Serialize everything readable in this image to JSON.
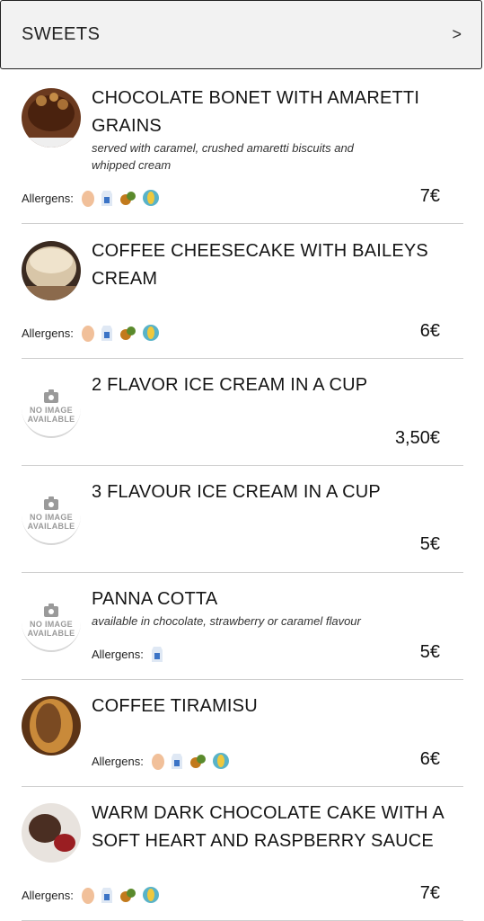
{
  "header": {
    "title": "SWEETS",
    "chevron": ">"
  },
  "allergens_label": "Allergens:",
  "no_image_line1": "NO IMAGE",
  "no_image_line2": "AVAILABLE",
  "items": [
    {
      "name": "CHOCOLATE BONET WITH AMARETTI GRAINS",
      "description": "served with caramel, crushed amaretti biscuits and whipped cream",
      "price": "7€",
      "allergens": [
        "egg-icon",
        "milk-icon",
        "nuts-icon",
        "gluten-icon"
      ]
    },
    {
      "name": "COFFEE CHEESECAKE WITH BAILEYS CREAM",
      "description": "",
      "price": "6€",
      "allergens": [
        "egg-icon",
        "milk-icon",
        "nuts-icon",
        "gluten-icon"
      ]
    },
    {
      "name": "2 FLAVOR ICE CREAM IN A CUP",
      "description": "",
      "price": "3,50€",
      "allergens": []
    },
    {
      "name": "3 FLAVOUR ICE CREAM IN A CUP",
      "description": "",
      "price": "5€",
      "allergens": []
    },
    {
      "name": "PANNA COTTA",
      "description": "available in chocolate, strawberry or caramel flavour",
      "price": "5€",
      "allergens": [
        "milk-icon"
      ]
    },
    {
      "name": "COFFEE TIRAMISU",
      "description": "",
      "price": "6€",
      "allergens": [
        "egg-icon",
        "milk-icon",
        "nuts-icon",
        "gluten-icon"
      ]
    },
    {
      "name": "WARM DARK CHOCOLATE CAKE WITH A SOFT HEART AND RASPBERRY SAUCE",
      "description": "",
      "price": "7€",
      "allergens": [
        "egg-icon",
        "milk-icon",
        "nuts-icon",
        "gluten-icon"
      ]
    }
  ]
}
